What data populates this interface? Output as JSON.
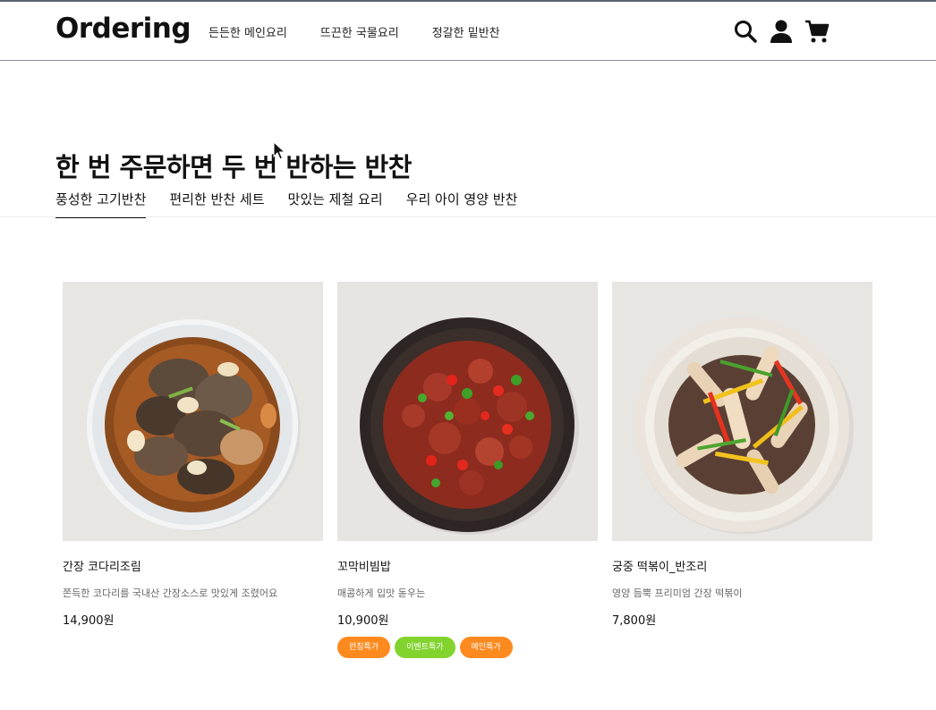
{
  "header": {
    "logo": "Ordering",
    "nav": [
      "든든한 메인요리",
      "뜨끈한 국물요리",
      "정갈한 밑반찬"
    ],
    "icons": [
      "search-icon",
      "user-icon",
      "cart-icon"
    ]
  },
  "hero": {
    "title": "한 번 주문하면 두 번 반하는 반찬"
  },
  "tabs": {
    "items": [
      "풍성한 고기반찬",
      "편리한 반찬 세트",
      "맛있는 제철 요리",
      "우리 아이 영양 반찬"
    ],
    "active_index": 0
  },
  "products": [
    {
      "name": "간장 코다리조림",
      "description": "쫀득한 코다리를 국내산 간장소스로 맛있게 조렸어요",
      "price": "14,900원",
      "badges": []
    },
    {
      "name": "꼬막비빔밥",
      "description": "매콤하게 입맛 돋우는",
      "price": "10,900원",
      "badges": [
        {
          "label": "런칭특가",
          "color": "#fd8a1e"
        },
        {
          "label": "이벤트특가",
          "color": "#82d32d"
        },
        {
          "label": "메인특가",
          "color": "#fd8a1e"
        }
      ]
    },
    {
      "name": "궁중 떡볶이_반조리",
      "description": "영양 듬뿍 프리미엄 간장 떡볶이",
      "price": "7,800원",
      "badges": []
    }
  ]
}
